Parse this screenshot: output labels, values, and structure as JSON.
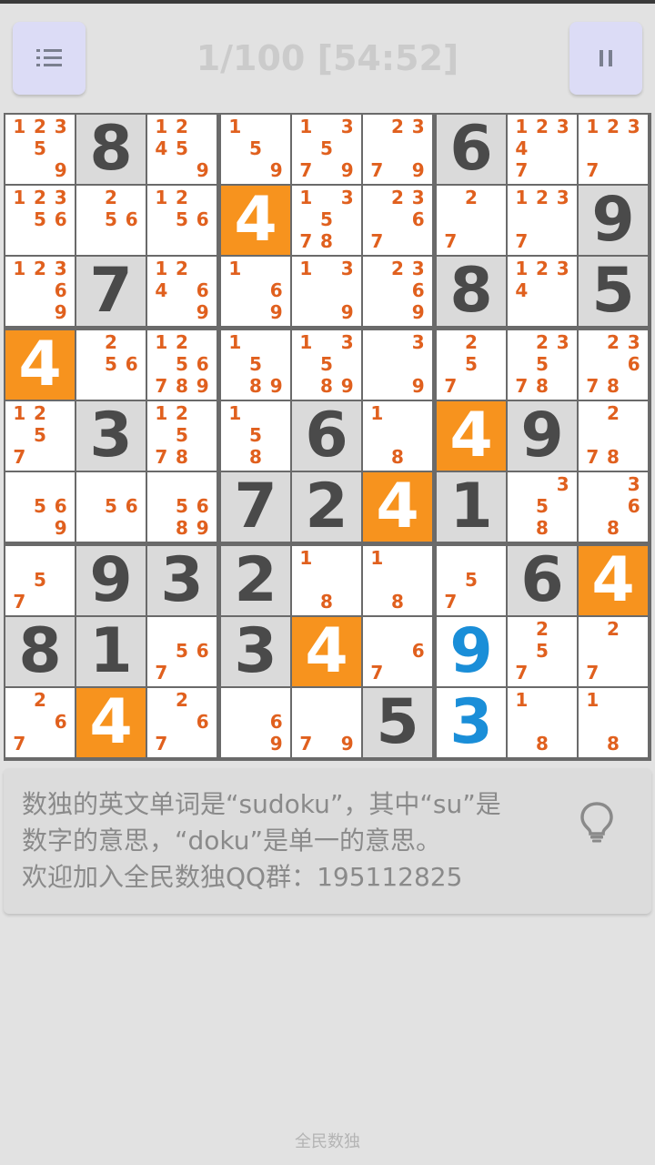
{
  "header": {
    "title": "1/100 [54:52]"
  },
  "colors": {
    "highlight": "#f7931e",
    "given_bg": "#dadada",
    "candidate": "#e0601e",
    "user_digit": "#1a8ed8"
  },
  "icons": {
    "menu": "list-icon",
    "pause": "pause-icon",
    "hint": "lightbulb-icon"
  },
  "board": {
    "rows": [
      [
        {
          "c": [
            1,
            2,
            3,
            5,
            9
          ]
        },
        {
          "v": 8,
          "t": "g"
        },
        {
          "c": [
            1,
            2,
            4,
            5,
            9
          ]
        },
        {
          "c": [
            1,
            5,
            9
          ]
        },
        {
          "c": [
            1,
            3,
            5,
            7,
            9
          ]
        },
        {
          "c": [
            2,
            3,
            7,
            9
          ]
        },
        {
          "v": 6,
          "t": "g"
        },
        {
          "c": [
            1,
            2,
            3,
            4,
            7
          ]
        },
        {
          "c": [
            1,
            2,
            3,
            7
          ]
        }
      ],
      [
        {
          "c": [
            1,
            2,
            3,
            5,
            6
          ]
        },
        {
          "c": [
            2,
            5,
            6
          ]
        },
        {
          "c": [
            1,
            2,
            5,
            6
          ]
        },
        {
          "v": 4,
          "t": "h"
        },
        {
          "c": [
            1,
            3,
            5,
            7,
            8
          ]
        },
        {
          "c": [
            2,
            3,
            6,
            7
          ]
        },
        {
          "c": [
            2,
            7
          ]
        },
        {
          "c": [
            1,
            2,
            3,
            7
          ]
        },
        {
          "v": 9,
          "t": "g"
        }
      ],
      [
        {
          "c": [
            1,
            2,
            3,
            6,
            9
          ]
        },
        {
          "v": 7,
          "t": "g"
        },
        {
          "c": [
            1,
            2,
            4,
            6,
            9
          ]
        },
        {
          "c": [
            1,
            6,
            9
          ]
        },
        {
          "c": [
            1,
            3,
            9
          ]
        },
        {
          "c": [
            2,
            3,
            6,
            9
          ]
        },
        {
          "v": 8,
          "t": "g"
        },
        {
          "c": [
            1,
            2,
            3,
            4
          ]
        },
        {
          "v": 5,
          "t": "g"
        }
      ],
      [
        {
          "v": 4,
          "t": "h"
        },
        {
          "c": [
            2,
            5,
            6
          ]
        },
        {
          "c": [
            1,
            2,
            5,
            6,
            7,
            8,
            9
          ]
        },
        {
          "c": [
            1,
            5,
            8,
            9
          ]
        },
        {
          "c": [
            1,
            3,
            5,
            8,
            9
          ]
        },
        {
          "c": [
            3,
            9
          ]
        },
        {
          "c": [
            2,
            5,
            7
          ]
        },
        {
          "c": [
            2,
            3,
            5,
            7,
            8
          ]
        },
        {
          "c": [
            2,
            3,
            6,
            7,
            8
          ]
        }
      ],
      [
        {
          "c": [
            1,
            2,
            5,
            7
          ]
        },
        {
          "v": 3,
          "t": "g"
        },
        {
          "c": [
            1,
            2,
            5,
            7,
            8
          ]
        },
        {
          "c": [
            1,
            5,
            8
          ]
        },
        {
          "v": 6,
          "t": "g"
        },
        {
          "c": [
            1,
            8
          ]
        },
        {
          "v": 4,
          "t": "h"
        },
        {
          "v": 9,
          "t": "g"
        },
        {
          "c": [
            2,
            7,
            8
          ]
        }
      ],
      [
        {
          "c": [
            5,
            6,
            9
          ]
        },
        {
          "c": [
            5,
            6
          ]
        },
        {
          "c": [
            5,
            6,
            8,
            9
          ]
        },
        {
          "v": 7,
          "t": "g"
        },
        {
          "v": 2,
          "t": "g"
        },
        {
          "v": 4,
          "t": "h"
        },
        {
          "v": 1,
          "t": "g"
        },
        {
          "c": [
            3,
            5,
            8
          ]
        },
        {
          "c": [
            3,
            6,
            8
          ]
        }
      ],
      [
        {
          "c": [
            5,
            7
          ]
        },
        {
          "v": 9,
          "t": "g"
        },
        {
          "v": 3,
          "t": "g"
        },
        {
          "v": 2,
          "t": "g"
        },
        {
          "c": [
            1,
            8
          ]
        },
        {
          "c": [
            1,
            8
          ]
        },
        {
          "c": [
            5,
            7
          ]
        },
        {
          "v": 6,
          "t": "g"
        },
        {
          "v": 4,
          "t": "h"
        }
      ],
      [
        {
          "v": 8,
          "t": "g"
        },
        {
          "v": 1,
          "t": "g"
        },
        {
          "c": [
            5,
            6,
            7
          ]
        },
        {
          "v": 3,
          "t": "g"
        },
        {
          "v": 4,
          "t": "h"
        },
        {
          "c": [
            6,
            7
          ]
        },
        {
          "v": 9,
          "t": "u"
        },
        {
          "c": [
            2,
            5,
            7
          ]
        },
        {
          "c": [
            2,
            7
          ]
        }
      ],
      [
        {
          "c": [
            2,
            6,
            7
          ]
        },
        {
          "v": 4,
          "t": "h"
        },
        {
          "c": [
            2,
            6,
            7
          ]
        },
        {
          "c": [
            6,
            9
          ]
        },
        {
          "c": [
            7,
            9
          ]
        },
        {
          "v": 5,
          "t": "g"
        },
        {
          "v": 3,
          "t": "u"
        },
        {
          "c": [
            1,
            8
          ]
        },
        {
          "c": [
            1,
            8
          ]
        }
      ]
    ]
  },
  "tip": {
    "lines": [
      "数独的英文单词是“sudoku”，其中“su”是",
      "数字的意思，“doku”是单一的意思。",
      "欢迎加入全民数独QQ群：195112825"
    ]
  },
  "footer": {
    "text": "全民数独"
  }
}
